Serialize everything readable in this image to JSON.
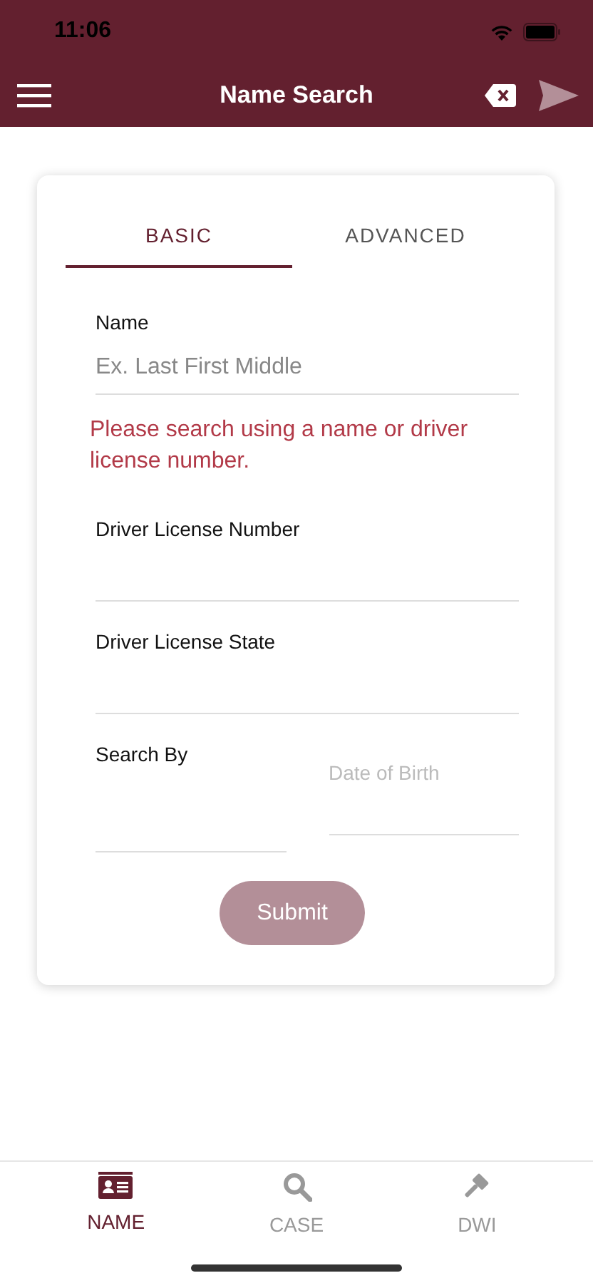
{
  "status_bar": {
    "time": "11:06"
  },
  "header": {
    "title": "Name Search"
  },
  "tabs": [
    {
      "label": "BASIC",
      "selected": true
    },
    {
      "label": "ADVANCED",
      "selected": false
    }
  ],
  "form": {
    "name": {
      "label": "Name",
      "placeholder": "Ex. Last First Middle"
    },
    "error": "Please search using a name or driver license number.",
    "license_number": {
      "label": "Driver License Number"
    },
    "license_state": {
      "label": "Driver License State"
    },
    "search_by": {
      "label": "Search By"
    },
    "date_of_birth": {
      "placeholder": "Date of Birth"
    },
    "submit": {
      "label": "Submit",
      "disabled": true
    }
  },
  "bottom_nav": [
    {
      "label": "NAME",
      "kind": "id-card",
      "selected": true
    },
    {
      "label": "CASE",
      "kind": "search",
      "selected": false
    },
    {
      "label": "DWI",
      "kind": "gavel",
      "selected": false
    }
  ]
}
